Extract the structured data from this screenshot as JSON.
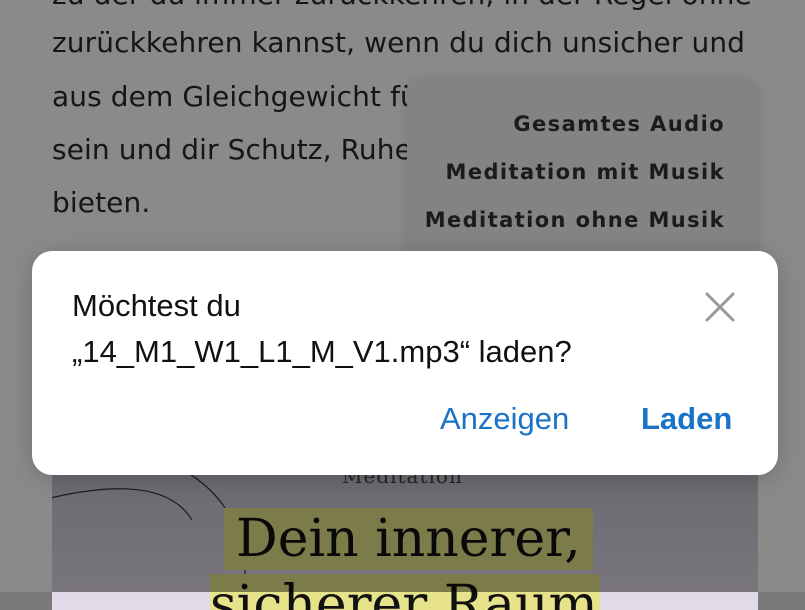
{
  "article": {
    "lines": [
      "zu der du immer zurückkehren, in der Regel ohne",
      "zurückkehren kannst, wenn du dich unsicher und",
      "aus dem Gleichgewicht fühlst",
      "sein und dir Schutz, Ruhe",
      "bieten."
    ],
    "hero_caption": "Meditation",
    "hero_title_line1": "Dein innerer,",
    "hero_title_line2": "sicherer Raum"
  },
  "audio_menu": {
    "items": [
      "Gesamtes Audio",
      "Meditation mit Musik",
      "Meditation ohne Musik"
    ]
  },
  "download_prompt": {
    "line1": "Möchtest du",
    "line2": "„14_M1_W1_L1_M_V1.mp3“ laden?",
    "show_label": "Anzeigen",
    "load_label": "Laden",
    "close_icon": "close-icon"
  },
  "colors": {
    "accent": "#1a73c7",
    "highlight": "#e6e38a",
    "overlay": "rgba(0,0,0,0.46)"
  }
}
